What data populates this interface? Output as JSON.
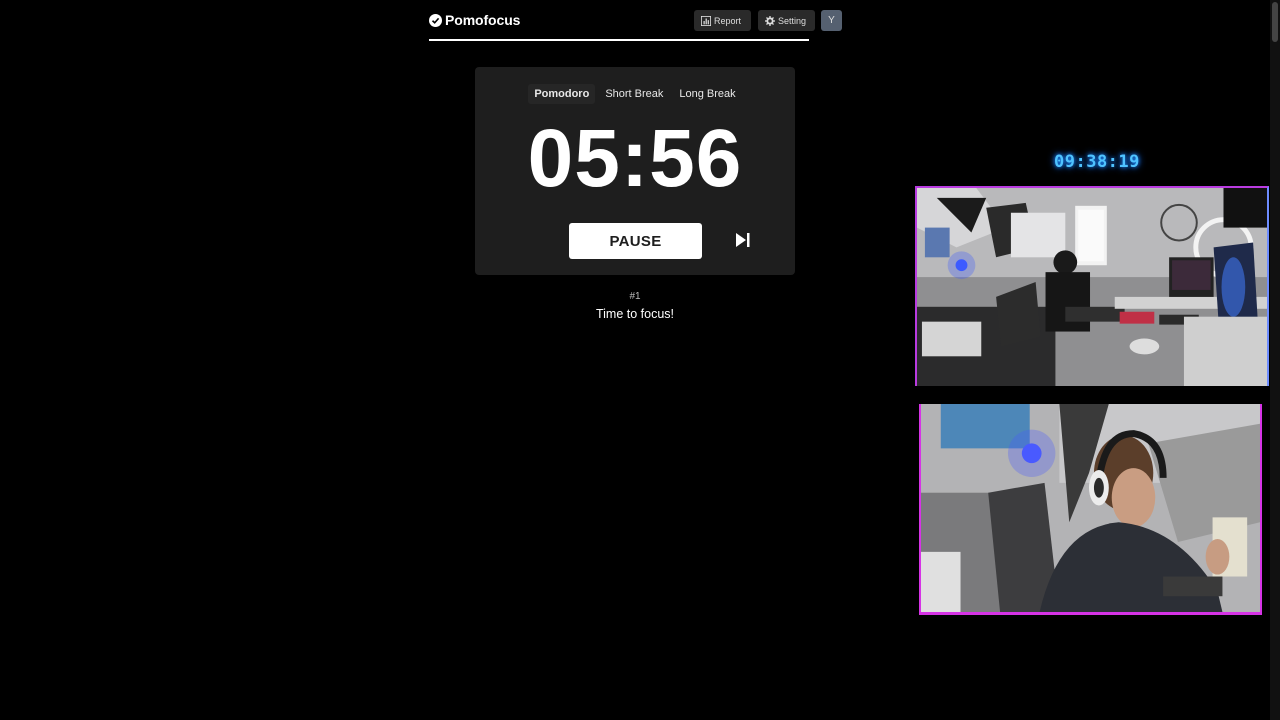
{
  "app": {
    "name": "Pomofocus",
    "logo_icon": "check-circle-icon"
  },
  "header": {
    "report_label": "Report",
    "report_icon": "bar-chart-icon",
    "setting_label": "Setting",
    "setting_icon": "gear-icon",
    "avatar_initial": "Y"
  },
  "progress": {
    "fraction": 1.0
  },
  "modes": [
    {
      "label": "Pomodoro",
      "active": true
    },
    {
      "label": "Short Break",
      "active": false
    },
    {
      "label": "Long Break",
      "active": false
    }
  ],
  "timer": {
    "time": "05:56",
    "pause_label": "PAUSE",
    "skip_icon": "skip-next-icon"
  },
  "session": {
    "round": "#1",
    "message": "Time to focus!"
  },
  "overlay": {
    "stream_clock": "09:38:19"
  },
  "colors": {
    "background": "#000000",
    "card": "#1e1e1e",
    "clock_glow": "#4fc3ff",
    "cam_border": "#d633e6"
  }
}
